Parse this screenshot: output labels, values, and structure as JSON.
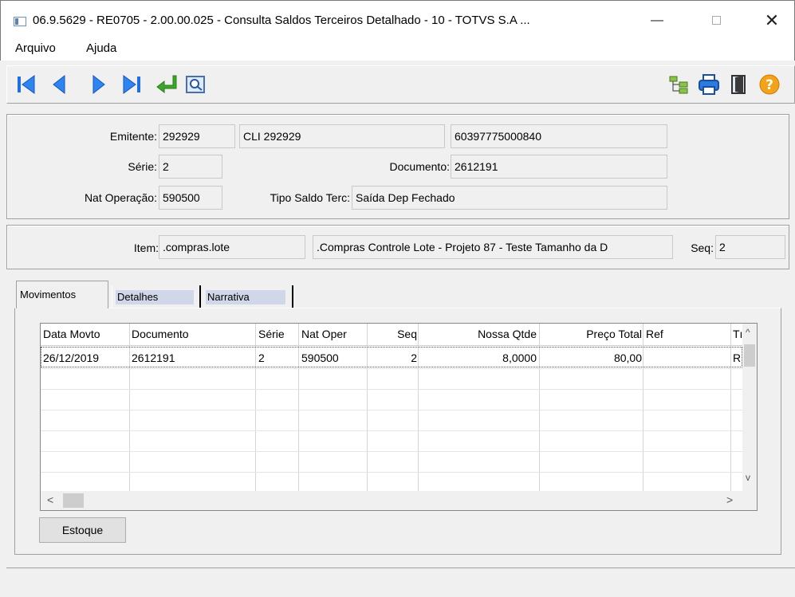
{
  "window": {
    "title": "06.9.5629 - RE0705 - 2.00.00.025 - Consulta Saldos Terceiros Detalhado - 10 - TOTVS S.A ...",
    "min_glyph": "—",
    "close_glyph": "✕"
  },
  "menu": {
    "file": "Arquivo",
    "help": "Ajuda"
  },
  "toolbar": {
    "left_icons": [
      "first-record-icon",
      "previous-record-icon",
      "next-record-icon",
      "last-record-icon",
      "return-icon",
      "search-preview-icon"
    ],
    "right_icons": [
      "tree-icon",
      "print-icon",
      "exit-door-icon",
      "help-icon"
    ]
  },
  "header": {
    "emitente_label": "Emitente:",
    "emitente_code": "292929",
    "emitente_name": "CLI 292929",
    "emitente_cnpj": "60397775000840",
    "serie_label": "Série:",
    "serie_value": "2",
    "documento_label": "Documento:",
    "documento_value": "2612191",
    "nat_label": "Nat Operação:",
    "nat_value": "590500",
    "tipo_label": "Tipo Saldo Terc:",
    "tipo_value": "Saída Dep Fechado"
  },
  "item": {
    "item_label": "Item:",
    "item_code": ".compras.lote",
    "item_desc": ".Compras Controle Lote - Projeto 87 - Teste Tamanho da D",
    "seq_label": "Seq:",
    "seq_value": "2"
  },
  "tabs": {
    "t1": "Movimentos",
    "t2": "Detalhes",
    "t3": "Narrativa"
  },
  "grid": {
    "headers": {
      "data": "Data Movto",
      "doc": "Documento",
      "serie": "Série",
      "nat": "Nat Oper",
      "seq": "Seq",
      "qtde": "Nossa Qtde",
      "preco": "Preço Total",
      "ref": "Ref",
      "tp": "Tı"
    },
    "row1": {
      "data": "26/12/2019",
      "doc": "2612191",
      "serie": "2",
      "nat": "590500",
      "seq": "2",
      "qtde": "8,0000",
      "preco": "80,00",
      "ref": "",
      "tp": "R"
    },
    "scroll_up": "^",
    "scroll_down": "v",
    "scroll_left": "<",
    "scroll_right": ">"
  },
  "buttons": {
    "estoque": "Estoque"
  },
  "colors": {
    "nav_blue": "#1f6fe0",
    "return_green": "#3fa52a",
    "help_orange": "#f3a21a"
  }
}
